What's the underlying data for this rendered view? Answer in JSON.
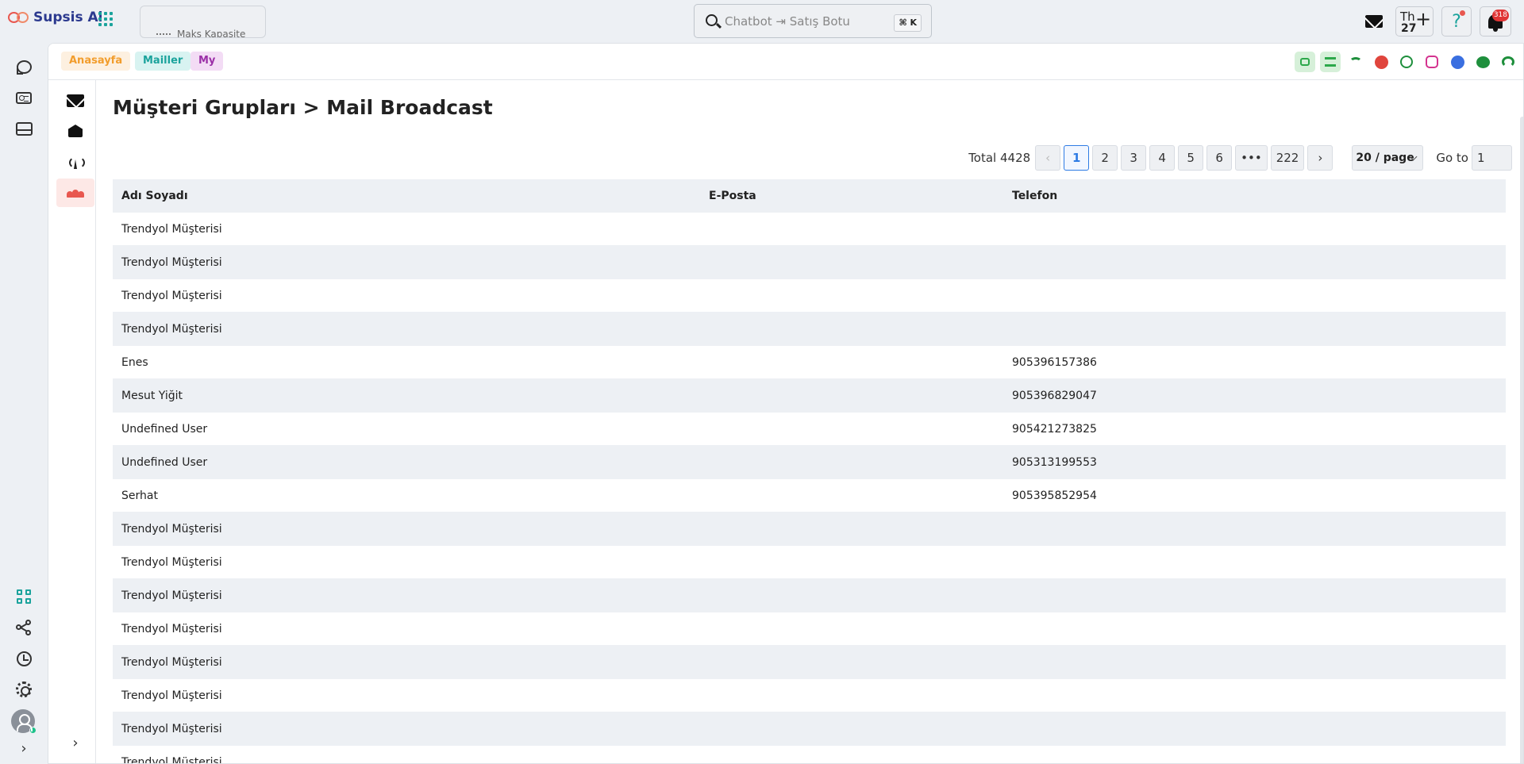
{
  "app": {
    "name": "Supsis Ai"
  },
  "header": {
    "capacity_label": "Maks Kapasite",
    "search_placeholder": "Chatbot ⇥ Satış Botu",
    "search_shortcut": "⌘ K",
    "calendar_day_label": "Th",
    "calendar_day_number": "27",
    "notification_count": "318"
  },
  "tabs": [
    {
      "label": "Anasayfa",
      "color": "#f29d2c"
    },
    {
      "label": "Mailler",
      "color": "#1ba39c"
    },
    {
      "label": "My",
      "color": "#9b2fa7"
    }
  ],
  "channels": [
    "bot-icon",
    "list-icon",
    "wifi-icon",
    "telegram-icon",
    "whatsapp-icon",
    "instagram-icon",
    "messenger-icon",
    "sms-icon",
    "headset-icon"
  ],
  "page": {
    "title": "Müşteri Grupları > Mail Broadcast"
  },
  "pagination": {
    "total_label": "Total 4428",
    "pages": [
      "1",
      "2",
      "3",
      "4",
      "5",
      "6"
    ],
    "ellipsis": "•••",
    "last_page": "222",
    "current_page": "1",
    "page_size": "20 / page",
    "goto_label": "Go to",
    "goto_value": "1"
  },
  "table": {
    "columns": [
      "Adı Soyadı",
      "E-Posta",
      "Telefon"
    ],
    "rows": [
      {
        "name": "Trendyol Müşterisi",
        "email": "",
        "phone": ""
      },
      {
        "name": "Trendyol Müşterisi",
        "email": "",
        "phone": ""
      },
      {
        "name": "Trendyol Müşterisi",
        "email": "",
        "phone": ""
      },
      {
        "name": "Trendyol Müşterisi",
        "email": "",
        "phone": ""
      },
      {
        "name": "Enes",
        "email": "",
        "phone": "905396157386"
      },
      {
        "name": "Mesut Yiğit",
        "email": "",
        "phone": "905396829047"
      },
      {
        "name": "Undefined User",
        "email": "",
        "phone": "905421273825"
      },
      {
        "name": "Undefined User",
        "email": "",
        "phone": "905313199553"
      },
      {
        "name": "Serhat",
        "email": "",
        "phone": "905395852954"
      },
      {
        "name": "Trendyol Müşterisi",
        "email": "",
        "phone": ""
      },
      {
        "name": "Trendyol Müşterisi",
        "email": "",
        "phone": ""
      },
      {
        "name": "Trendyol Müşterisi",
        "email": "",
        "phone": ""
      },
      {
        "name": "Trendyol Müşterisi",
        "email": "",
        "phone": ""
      },
      {
        "name": "Trendyol Müşterisi",
        "email": "",
        "phone": ""
      },
      {
        "name": "Trendyol Müşterisi",
        "email": "",
        "phone": ""
      },
      {
        "name": "Trendyol Müşterisi",
        "email": "",
        "phone": ""
      },
      {
        "name": "Trendyol Müşterisi",
        "email": "",
        "phone": ""
      }
    ]
  },
  "colors": {
    "accent": "#1ba39c",
    "brand": "#2c3a8f",
    "active_page": "#2e7be4",
    "active_subnav": "#e8574f"
  }
}
